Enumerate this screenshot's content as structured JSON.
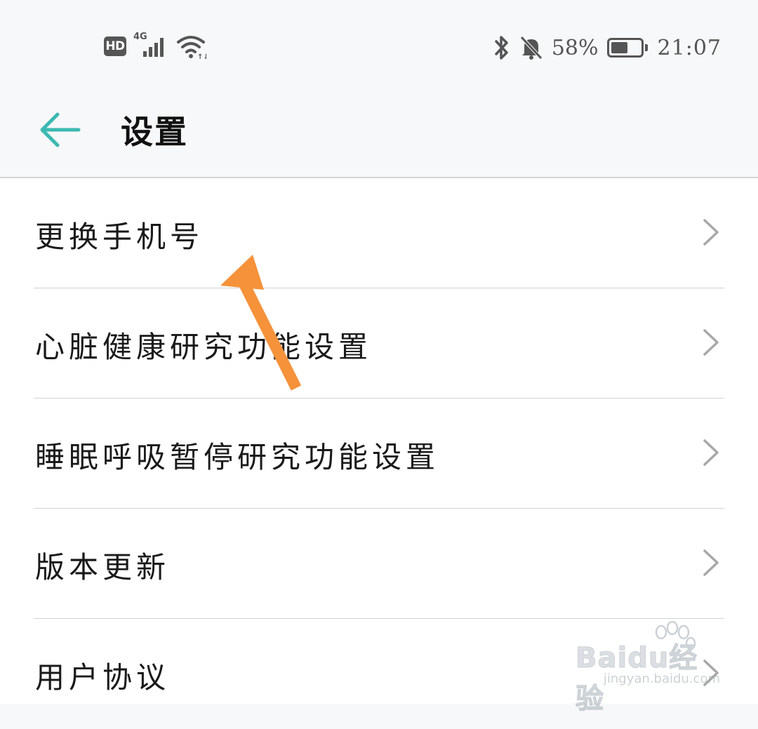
{
  "status_bar": {
    "hd_label": "HD",
    "network_type": "4G",
    "battery_percent": "58%",
    "battery_level": 0.58,
    "time": "21:07",
    "icons": [
      "hd-icon",
      "signal-icon",
      "wifi-icon",
      "bluetooth-icon",
      "bell-muted-icon",
      "battery-icon"
    ]
  },
  "header": {
    "back_icon": "arrow-left-icon",
    "title": "设置",
    "accent_color": "#3cb8b0"
  },
  "settings": {
    "items": [
      {
        "label": "更换手机号"
      },
      {
        "label": "心脏健康研究功能设置"
      },
      {
        "label": "睡眠呼吸暂停研究功能设置"
      },
      {
        "label": "版本更新"
      },
      {
        "label": "用户协议"
      }
    ]
  },
  "annotation": {
    "arrow_color": "#f5923a"
  },
  "watermark": {
    "main": "Baidu经验",
    "sub": "jingyan.baidu.com"
  }
}
